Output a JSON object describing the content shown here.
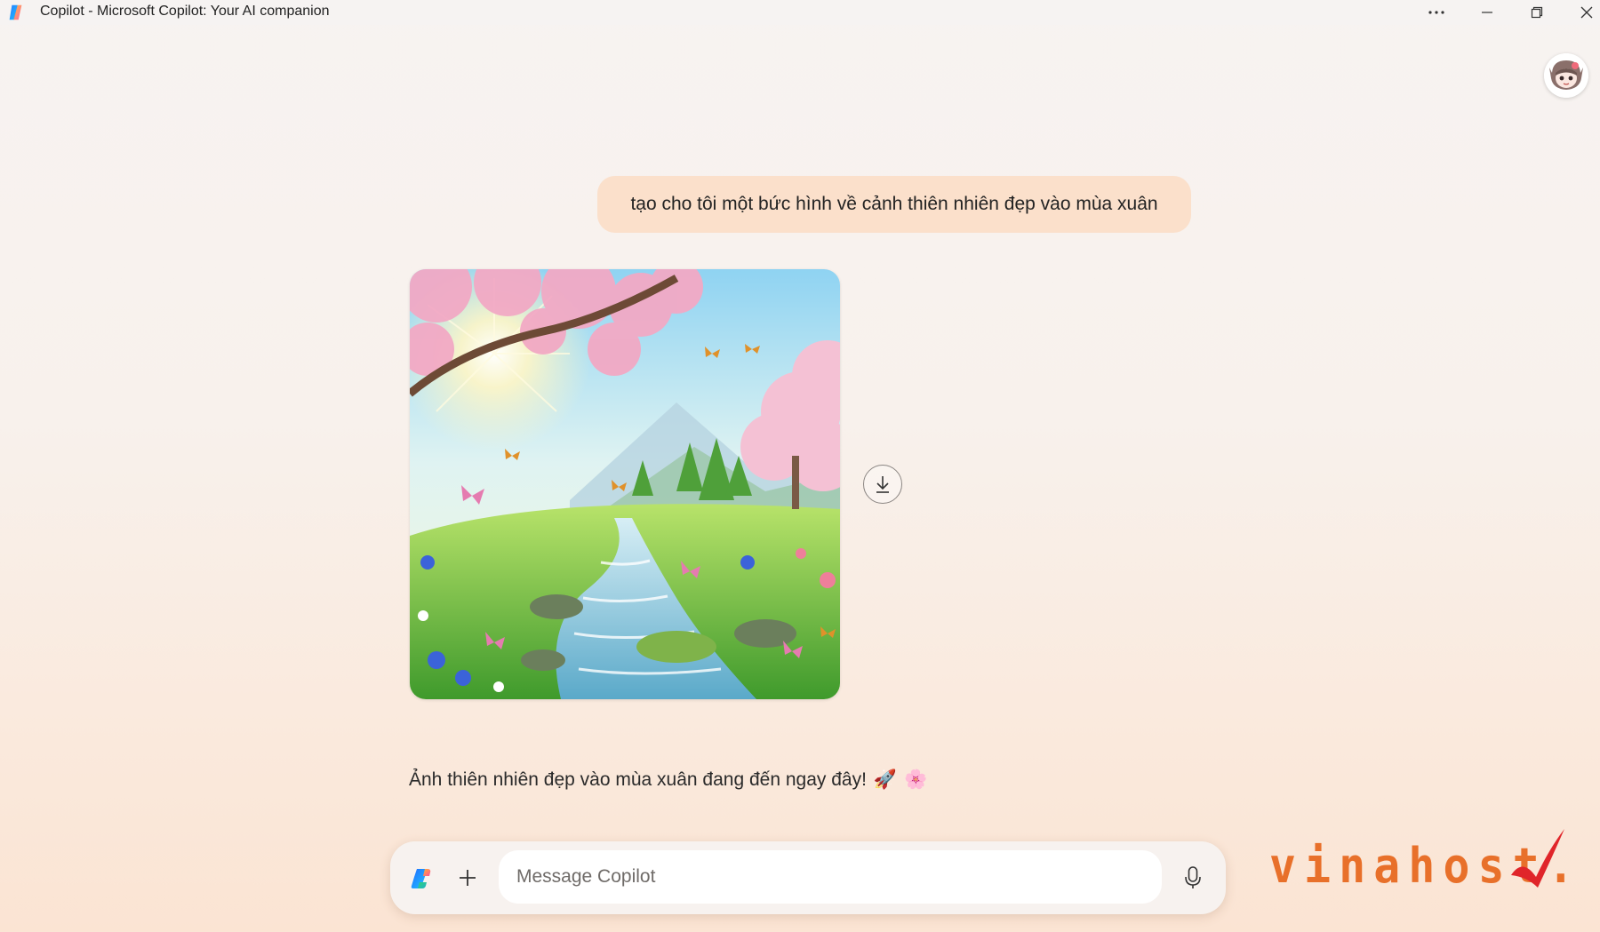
{
  "window": {
    "title": "Copilot - Microsoft Copilot: Your AI companion",
    "controls": {
      "more_icon": "ellipsis-icon",
      "minimize_icon": "minimize-icon",
      "maximize_icon": "restore-icon",
      "close_icon": "close-icon"
    }
  },
  "conversation": {
    "user_message": "tạo cho tôi một bức hình về cảnh thiên nhiên đẹp vào mùa xuân",
    "generated_image": {
      "subject": "spring landscape with cherry blossoms, stream, butterflies and sun",
      "download_icon": "download-icon"
    },
    "assistant_reply": "Ảnh thiên nhiên đẹp vào mùa xuân đang đến ngay đây!",
    "assistant_emojis": [
      "🚀",
      "🌸"
    ]
  },
  "composer": {
    "placeholder": "Message Copilot",
    "value": "",
    "logo_icon": "copilot-logo-icon",
    "add_icon": "plus-icon",
    "mic_icon": "microphone-icon"
  },
  "watermark": {
    "text": "vinahost"
  },
  "colors": {
    "user_bubble": "#fbe0cb",
    "watermark_orange": "#e8702a",
    "watermark_red": "#e0252a"
  }
}
